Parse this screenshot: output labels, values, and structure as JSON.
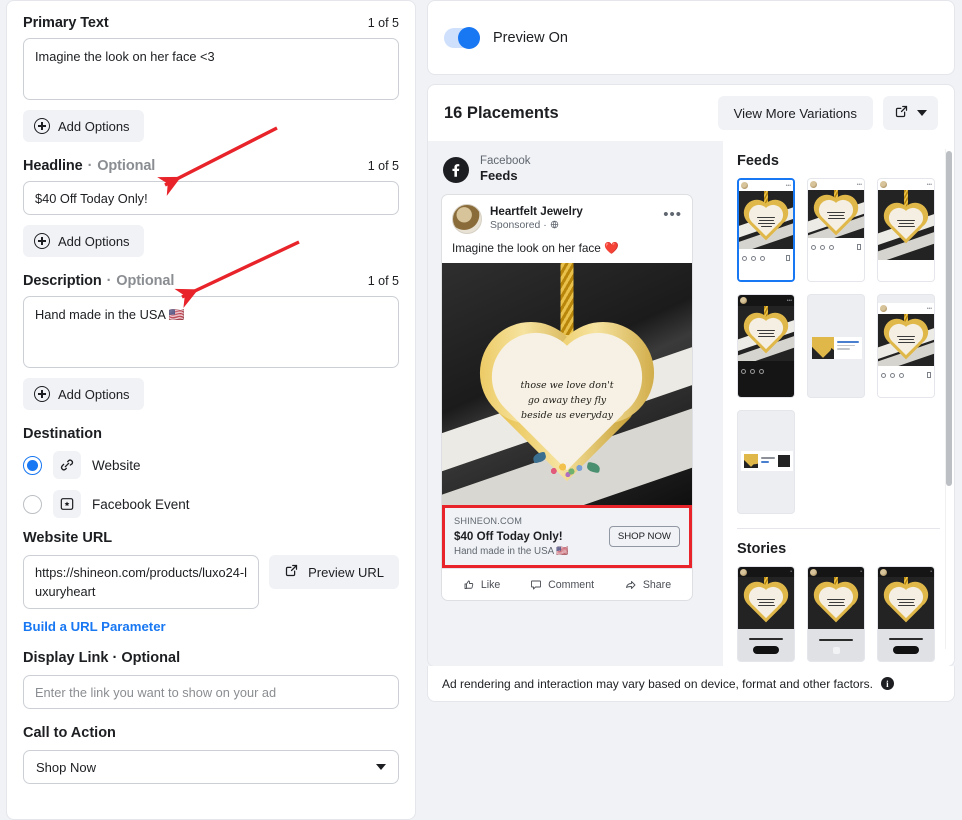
{
  "left_form": {
    "primary_text": {
      "label": "Primary Text",
      "counter": "1 of 5",
      "value": "Imagine the look on her face <3",
      "add_options": "Add Options"
    },
    "headline": {
      "label": "Headline",
      "optional": "Optional",
      "counter": "1 of 5",
      "value": "$40 Off Today Only!",
      "add_options": "Add Options"
    },
    "description": {
      "label": "Description",
      "optional": "Optional",
      "counter": "1 of 5",
      "value": "Hand made in the USA 🇺🇸",
      "add_options": "Add Options"
    },
    "destination": {
      "label": "Destination",
      "options": [
        {
          "label": "Website",
          "icon": "link-icon",
          "selected": true
        },
        {
          "label": "Facebook Event",
          "icon": "event-icon",
          "selected": false
        }
      ]
    },
    "website_url": {
      "label": "Website URL",
      "value": "https://shineon.com/products/luxo24-luxuryheart",
      "preview_button": "Preview URL"
    },
    "build_url_parameter": "Build a URL Parameter",
    "display_link": {
      "label": "Display Link",
      "optional": "Optional",
      "placeholder": "Enter the link you want to show on your ad",
      "value": ""
    },
    "call_to_action": {
      "label": "Call to Action",
      "value": "Shop Now"
    }
  },
  "preview": {
    "toggle_label": "Preview On",
    "toggle_on": true,
    "placements_title": "16 Placements",
    "view_more_variations": "View More Variations",
    "platform": "Facebook",
    "placement_name": "Feeds",
    "ad": {
      "brand": "Heartfelt Jewelry",
      "sponsored": "Sponsored",
      "body_text": "Imagine the look on her face ❤️",
      "engraving": "those we love don't go away they fly beside us everyday",
      "link_domain": "SHINEON.COM",
      "link_title": "$40 Off Today Only!",
      "link_description": "Hand made in the USA 🇺🇸",
      "cta_button": "SHOP NOW",
      "actions": [
        "Like",
        "Comment",
        "Share"
      ]
    },
    "groups": [
      {
        "title": "Feeds"
      },
      {
        "title": "Stories"
      }
    ],
    "disclaimer": "Ad rendering and interaction may vary based on device, format and other factors."
  },
  "colors": {
    "accent_blue": "#1877f2",
    "link_blue": "#1877f2",
    "annotation_red": "#e8232a",
    "panel_bg": "#f0f2f5",
    "border": "#e4e6eb"
  }
}
